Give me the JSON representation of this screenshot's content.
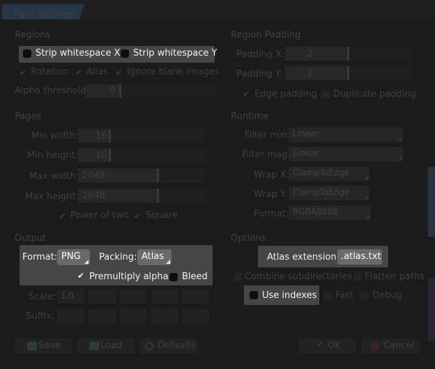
{
  "window": {
    "title": "Pack Settings"
  },
  "regions": {
    "heading": "Regions",
    "strip_x": "Strip whitespace X",
    "strip_y": "Strip whitespace Y",
    "rotation": "Rotation",
    "alias": "Alias",
    "ignore_blank": "Ignore blank images",
    "alpha_label": "Alpha threshold:",
    "alpha_value": "0"
  },
  "padding": {
    "heading": "Region Padding",
    "x_label": "Padding X:",
    "x_value": "2",
    "y_label": "Padding Y:",
    "y_value": "2",
    "edge": "Edge padding",
    "duplicate": "Duplicate padding"
  },
  "pages": {
    "heading": "Pages",
    "min_width_label": "Min width:",
    "min_width": "16",
    "min_height_label": "Min height:",
    "min_height": "16",
    "max_width_label": "Max width:",
    "max_width": "2048",
    "max_height_label": "Max height:",
    "max_height": "2048",
    "pot": "Power of two",
    "square": "Square"
  },
  "runtime": {
    "heading": "Runtime",
    "filter_min_label": "Filter min:",
    "filter_min": "Linear",
    "filter_mag_label": "Filter mag:",
    "filter_mag": "Linear",
    "wrap_x_label": "Wrap X:",
    "wrap_x": "ClampToEdge",
    "wrap_y_label": "Wrap Y:",
    "wrap_y": "ClampToEdge",
    "format_label": "Format:",
    "format": "RGBA8888"
  },
  "output": {
    "heading": "Output",
    "format_label": "Format:",
    "format": "PNG",
    "packing_label": "Packing:",
    "packing": "Atlas",
    "premultiply": "Premultiply alpha",
    "bleed": "Bleed",
    "scale_label": "Scale:",
    "scale_value": "1.0",
    "suffix_label": "Suffix:"
  },
  "options": {
    "heading": "Options",
    "atlas_ext_label": "Atlas extension:",
    "atlas_ext": ".atlas.txt",
    "combine": "Combine subdirectories",
    "flatten": "Flatten paths",
    "use_indexes": "Use indexes",
    "fast": "Fast",
    "debug": "Debug"
  },
  "buttons": {
    "save": "Save",
    "load": "Load",
    "defaults": "Defaults",
    "ok": "OK",
    "cancel": "Cancel"
  },
  "colors": {
    "accent": "#263648",
    "highlight_panel": "#464646",
    "select_bg": "#6a6a6a"
  }
}
